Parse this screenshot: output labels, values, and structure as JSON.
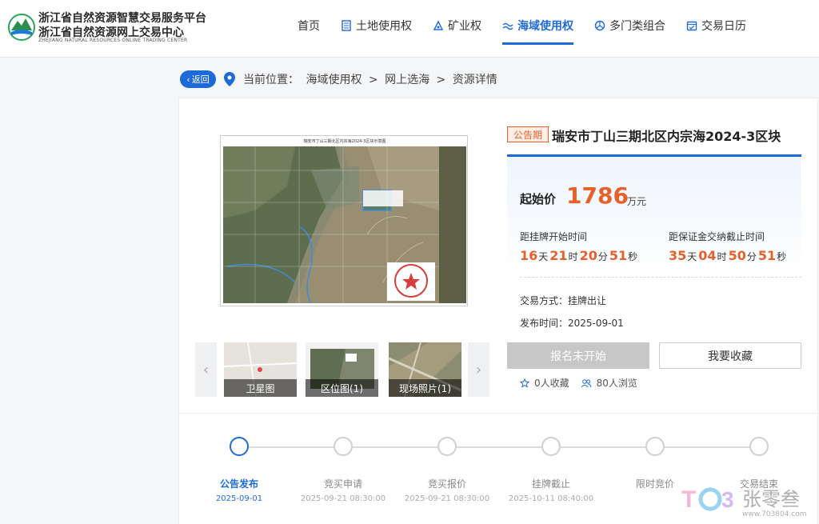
{
  "header": {
    "logo_line1": "浙江省自然资源智慧交易服务平台",
    "logo_line2": "浙江省自然资源网上交易中心",
    "logo_line3": "ZHEJIANG NATURAL RESOURCES ONLINE TRADING CENTER",
    "nav": [
      {
        "label": "首页",
        "icon": ""
      },
      {
        "label": "土地使用权",
        "icon": "building-icon"
      },
      {
        "label": "矿业权",
        "icon": "mine-icon"
      },
      {
        "label": "海域使用权",
        "icon": "wave-icon",
        "active": true
      },
      {
        "label": "多门类组合",
        "icon": "combo-icon"
      },
      {
        "label": "交易日历",
        "icon": "calendar-icon"
      }
    ]
  },
  "breadcrumb": {
    "back_label": "返回",
    "prefix": "当前位置：",
    "items": [
      "海域使用权",
      "网上选海",
      "资源详情"
    ],
    "separator": ">"
  },
  "gallery": {
    "map_title": "瑞安市丁山三期北区内宗海2024-3区块示意图",
    "thumbnails": [
      "卫星图",
      "区位图(1)",
      "现场照片(1)"
    ]
  },
  "detail": {
    "status": "公告期",
    "title": "瑞安市丁山三期北区内宗海2024-3区块",
    "price_label": "起始价",
    "price_value": "1786",
    "price_unit": "万元",
    "countdown1": {
      "label": "距挂牌开始时间",
      "days": "16",
      "hours": "21",
      "minutes": "20",
      "seconds": "51"
    },
    "countdown2": {
      "label": "距保证金交纳截止时间",
      "days": "35",
      "hours": "04",
      "minutes": "50",
      "seconds": "51"
    },
    "units": {
      "day": "天",
      "hour": "时",
      "minute": "分",
      "second": "秒"
    },
    "trade_method_label": "交易方式：",
    "trade_method": "挂牌出让",
    "publish_label": "发布时间：",
    "publish_date": "2025-09-01",
    "signup_button": "报名未开始",
    "favorite_button": "我要收藏",
    "favorites": "0人收藏",
    "views": "80人浏览"
  },
  "timeline": [
    {
      "label": "公告发布",
      "date": "2025-09-01",
      "active": true
    },
    {
      "label": "竞买申请",
      "date": "2025-09-21 08:30:00"
    },
    {
      "label": "竞买报价",
      "date": "2025-09-21 08:30:00"
    },
    {
      "label": "挂牌截止",
      "date": "2025-10-11 08:40:00"
    },
    {
      "label": "限时竞价",
      "date": ""
    },
    {
      "label": "交易结束",
      "date": ""
    }
  ],
  "watermark": {
    "text": "张零叁",
    "url": "www.703804.com"
  },
  "colors": {
    "brand": "#1d6ad8",
    "accent": "#e6612a",
    "disabled": "#c7c7c7"
  }
}
